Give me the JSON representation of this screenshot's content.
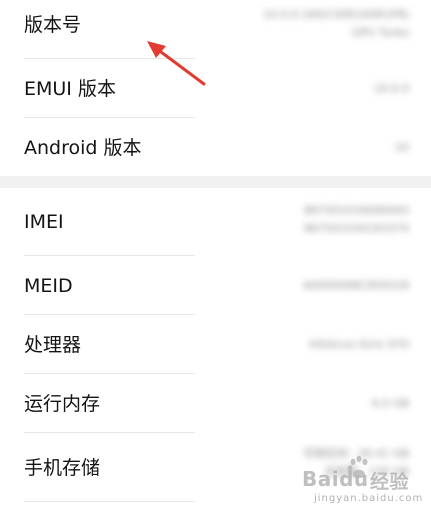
{
  "rows": [
    {
      "label": "版本号",
      "value_line1": "10.0.0.160(C00E160R1P8)",
      "value_line2": "GPU Turbo"
    },
    {
      "label": "EMUI 版本",
      "value_line1": "10.0.0"
    },
    {
      "label": "Android 版本",
      "value_line1": "10"
    },
    {
      "label": "IMEI",
      "value_line1": "867501034090093",
      "value_line2": "867501034193374"
    },
    {
      "label": "MEID",
      "value_line1": "A0000098C959318"
    },
    {
      "label": "处理器",
      "value_line1": "HiSilicon Kirin 970"
    },
    {
      "label": "运行内存",
      "value_line1": "6.0 GB"
    },
    {
      "label": "手机存储",
      "value_line1": "可用空间：26.41 GB",
      "value_line2": "总容量：128 GB"
    }
  ],
  "watermark": {
    "brand": "Baidu",
    "brand_cn": "经验",
    "sub": "jingyan.baidu.com"
  },
  "colors": {
    "arrow": "#e23b32",
    "divider": "#e8e8e8",
    "section_gap": "#f1f1f1"
  }
}
